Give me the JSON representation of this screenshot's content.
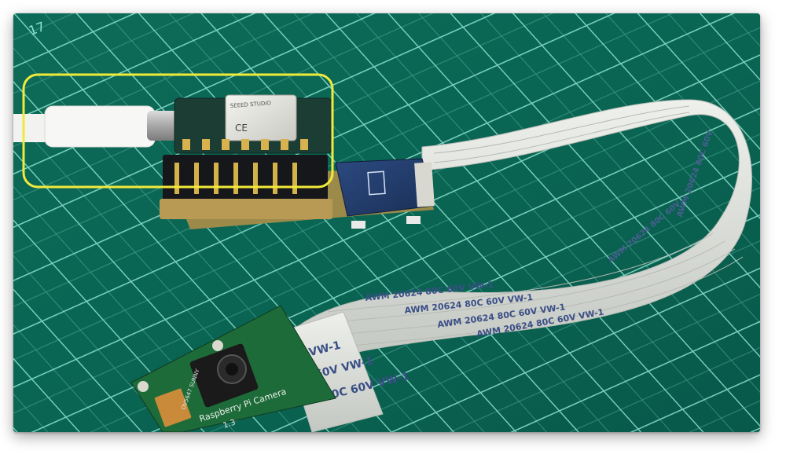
{
  "photo": {
    "subject": "Seeed Studio XIAO board with camera expansion connected by ribbon cable to Raspberry Pi Camera on cutting mat",
    "cable_print_1": "AWM  20624  80C  60V  VW-1",
    "cable_print_2": "AWM  20624  80C  60V  VW-1",
    "cable_print_3": "AWM  20624  80C  60V  VW-1",
    "cable_print_4": "AWM  20624  80C  60V  VW-1",
    "cable_print_5": "AWM  20624  80C  60V",
    "cable_print_6": "AWM  20624  80C  60V",
    "cable_end_1": "V  VW-1",
    "cable_end_2": "C  60V  VW-1",
    "cable_end_3": "C  80C  60V  VW-1",
    "camera_label": "Raspberry Pi Camera",
    "camera_version": "1.3",
    "sensor_label": "OV5647 SUNNY",
    "module_brand": "SEEED STUDIO",
    "mat_mark": "17",
    "highlight_color": "#f2ea3a",
    "mat_color": "#0b6a58",
    "grid_color": "#7fd9c8"
  }
}
